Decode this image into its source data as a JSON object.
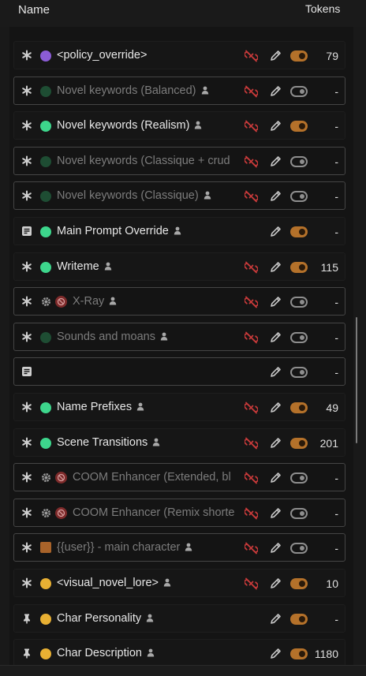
{
  "header": {
    "name_label": "Name",
    "tokens_label": "Tokens"
  },
  "colors": {
    "toggle_on": "#b4712a",
    "no_link_icon": "#c73a3a",
    "dot_purple": "#8b5cd6",
    "dot_green": "#3dd68c",
    "dot_dim_green": "#1e4d33",
    "dot_yellow": "#e8b033"
  },
  "rows": [
    {
      "label": "<policy_override>",
      "icon": "asterisk-icon",
      "dot": "purple",
      "enabled": true,
      "person": false,
      "no_link": true,
      "toggle": "on",
      "tokens": "79"
    },
    {
      "label": "Novel keywords (Balanced)",
      "icon": "asterisk-icon",
      "dot": "dim-green",
      "enabled": false,
      "person": true,
      "no_link": true,
      "toggle": "off",
      "tokens": "-"
    },
    {
      "label": "Novel keywords (Realism)",
      "icon": "asterisk-icon",
      "dot": "green",
      "enabled": true,
      "person": true,
      "no_link": true,
      "toggle": "on",
      "tokens": "-"
    },
    {
      "label": "Novel keywords (Classique + crud",
      "icon": "asterisk-icon",
      "dot": "dim-green",
      "enabled": false,
      "person": false,
      "no_link": true,
      "toggle": "off",
      "tokens": "-"
    },
    {
      "label": "Novel keywords (Classique)",
      "icon": "asterisk-icon",
      "dot": "dim-green",
      "enabled": false,
      "person": true,
      "no_link": true,
      "toggle": "off",
      "tokens": "-"
    },
    {
      "label": "Main Prompt Override",
      "icon": "note-icon",
      "dot": "green",
      "enabled": true,
      "person": true,
      "no_link": false,
      "toggle": "on",
      "tokens": "-"
    },
    {
      "label": "Writeme",
      "icon": "asterisk-icon",
      "dot": "green",
      "enabled": true,
      "person": true,
      "no_link": true,
      "toggle": "on",
      "tokens": "115"
    },
    {
      "label": "X-Ray",
      "icon": "asterisk-icon",
      "dot": "gear-badge",
      "enabled": false,
      "person": true,
      "no_link": true,
      "toggle": "off",
      "tokens": "-"
    },
    {
      "label": "Sounds and moans",
      "icon": "asterisk-icon",
      "dot": "dim-green",
      "enabled": false,
      "person": true,
      "no_link": true,
      "toggle": "off",
      "tokens": "-"
    },
    {
      "label": "",
      "icon": "note-icon",
      "dot": "none",
      "enabled": false,
      "person": false,
      "no_link": false,
      "toggle": "off",
      "tokens": "-"
    },
    {
      "label": "Name Prefixes",
      "icon": "asterisk-icon",
      "dot": "green",
      "enabled": true,
      "person": true,
      "no_link": true,
      "toggle": "on",
      "tokens": "49"
    },
    {
      "label": "Scene Transitions",
      "icon": "asterisk-icon",
      "dot": "green",
      "enabled": true,
      "person": true,
      "no_link": true,
      "toggle": "on",
      "tokens": "201"
    },
    {
      "label": "COOM Enhancer (Extended, bl",
      "icon": "asterisk-icon",
      "dot": "gear-badge",
      "enabled": false,
      "person": false,
      "no_link": true,
      "toggle": "off",
      "tokens": "-"
    },
    {
      "label": "COOM Enhancer (Remix shorte",
      "icon": "asterisk-icon",
      "dot": "gear-badge",
      "enabled": false,
      "person": false,
      "no_link": true,
      "toggle": "off",
      "tokens": "-"
    },
    {
      "label": "{{user}} - main character",
      "icon": "asterisk-icon",
      "dot": "orange-square",
      "enabled": false,
      "person": true,
      "no_link": true,
      "toggle": "off",
      "tokens": "-"
    },
    {
      "label": "<visual_novel_lore>",
      "icon": "asterisk-icon",
      "dot": "yellow",
      "enabled": true,
      "person": true,
      "no_link": true,
      "toggle": "on",
      "tokens": "10"
    },
    {
      "label": "Char Personality",
      "icon": "pin-icon",
      "dot": "yellow",
      "enabled": true,
      "person": true,
      "no_link": false,
      "toggle": "on",
      "tokens": "-"
    },
    {
      "label": "Char Description",
      "icon": "pin-icon",
      "dot": "yellow",
      "enabled": true,
      "person": true,
      "no_link": false,
      "toggle": "on",
      "tokens": "1180"
    }
  ]
}
